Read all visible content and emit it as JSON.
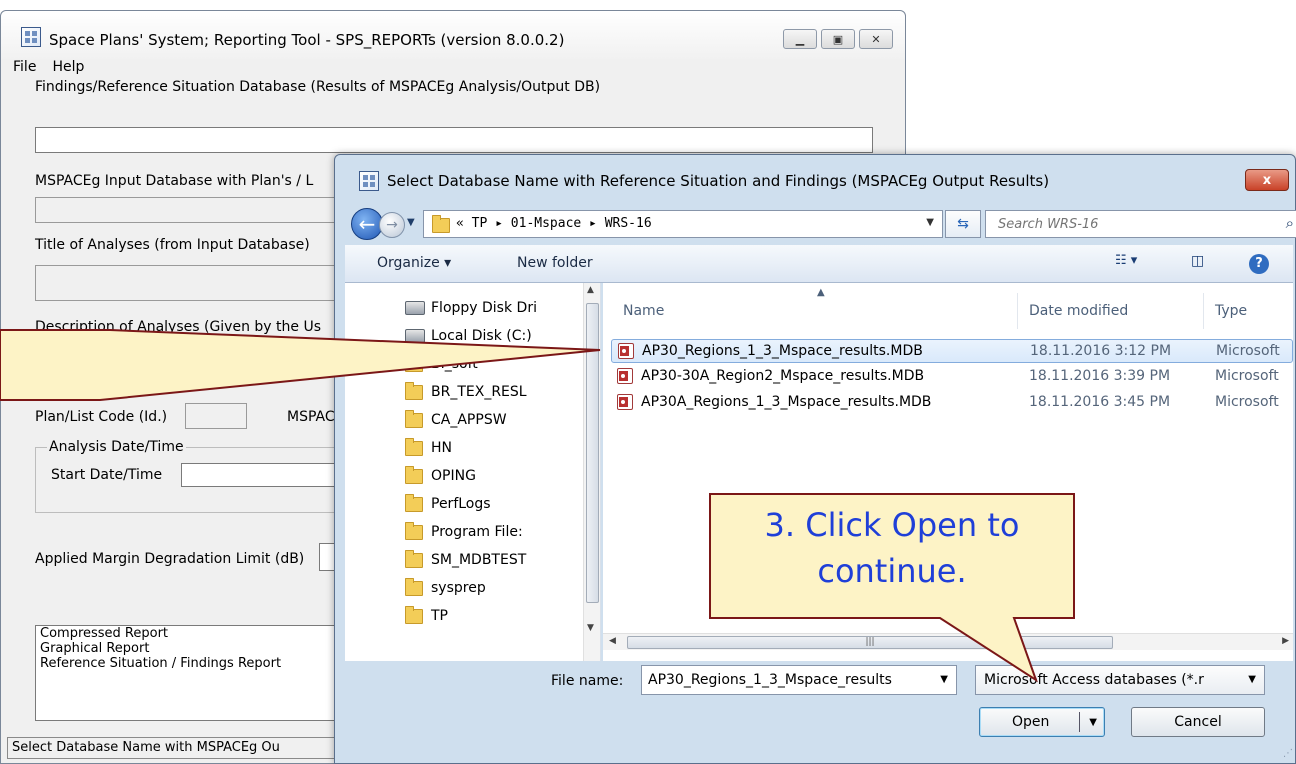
{
  "main_window": {
    "title": "Space Plans' System; Reporting Tool - SPS_REPORTs (version 8.0.0.2)",
    "menu": [
      "File",
      "Help"
    ],
    "label_findings_db": "Findings/Reference Situation Database (Results of MSPACEg Analysis/Output DB)",
    "label_input_db": "MSPACEg Input Database with Plan's / L",
    "label_title": "Title of Analyses (from Input Database)",
    "label_description": "Description of Analyses (Given by the Us",
    "label_plan_code": "Plan/List Code (Id.)",
    "label_mspac": "MSPAC",
    "group_analysis_datetime": "Analysis Date/Time",
    "label_start_datetime": "Start Date/Time",
    "label_margin": "Applied Margin Degradation Limit (dB)",
    "report_list": [
      "Compressed Report",
      "Graphical Report",
      "Reference Situation / Findings Report"
    ],
    "status_text": "Select Database Name with MSPACEg Ou"
  },
  "dialog": {
    "title": "Select Database Name with Reference Situation and Findings (MSPACEg Output Results)",
    "close_label": "x",
    "breadcrumb": "« TP ▸ 01-Mspace ▸ WRS-16",
    "search_placeholder": "Search WRS-16",
    "toolbar": {
      "organize": "Organize ▾",
      "new_folder": "New folder"
    },
    "nav_items": [
      "Floppy Disk Dri",
      "Local Disk (C:)",
      "BI_soft",
      "BR_TEX_RESL",
      "CA_APPSW",
      "HN",
      "OPING",
      "PerfLogs",
      "Program File:",
      "SM_MDBTEST",
      "sysprep",
      "TP"
    ],
    "columns": {
      "name": "Name",
      "date": "Date modified",
      "type": "Type"
    },
    "files": [
      {
        "name": "AP30_Regions_1_3_Mspace_results.MDB",
        "date": "18.11.2016 3:12 PM",
        "type": "Microsoft",
        "selected": true
      },
      {
        "name": "AP30-30A_Region2_Mspace_results.MDB",
        "date": "18.11.2016 3:39 PM",
        "type": "Microsoft",
        "selected": false
      },
      {
        "name": "AP30A_Regions_1_3_Mspace_results.MDB",
        "date": "18.11.2016 3:45 PM",
        "type": "Microsoft",
        "selected": false
      }
    ],
    "file_name_label": "File name:",
    "file_name_value": "AP30_Regions_1_3_Mspace_results",
    "file_type_value": "Microsoft Access databases (*.r",
    "open_label": "Open",
    "cancel_label": "Cancel"
  },
  "callout": {
    "text_line1": "3. Click Open to",
    "text_line2": "continue.",
    "fill_color": "#fdf3c6",
    "border_color": "#7b1717",
    "text_color": "#1f3fd8"
  },
  "icons": {
    "app": "app-grid-icon",
    "back": "back-arrow-icon",
    "forward": "forward-arrow-icon",
    "folder": "folder-icon",
    "mdb": "access-db-icon",
    "search": "search-icon",
    "help": "help-icon"
  }
}
